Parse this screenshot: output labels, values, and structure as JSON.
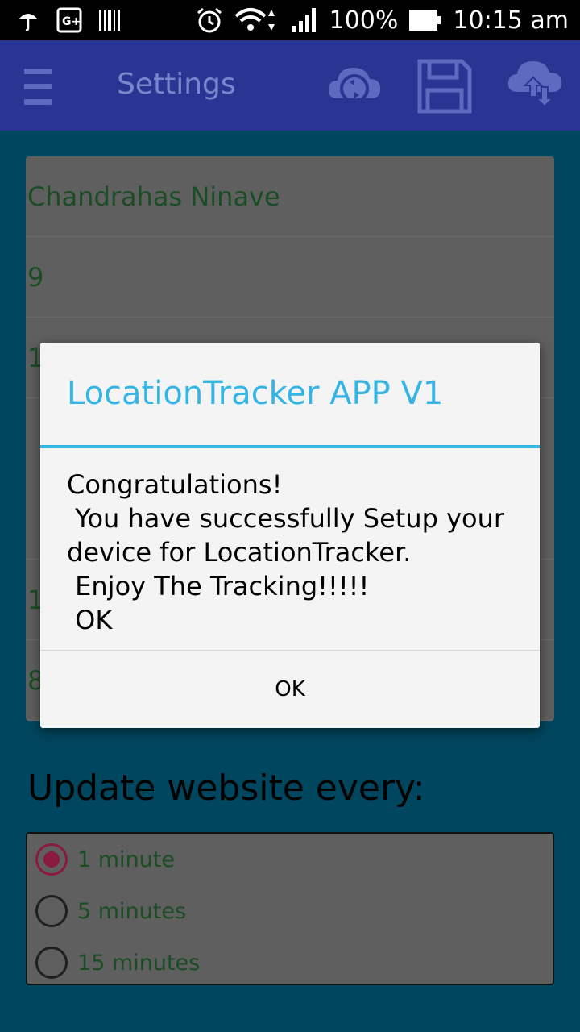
{
  "status_bar": {
    "icons": [
      "umbrella-icon",
      "gplus-icon",
      "barcode-icon",
      "alarm-icon",
      "wifi-icon",
      "signal-icon",
      "battery-icon"
    ],
    "battery": "100%",
    "time": "10:15 am"
  },
  "app_bar": {
    "title": "Settings",
    "icons": [
      "menu-icon",
      "cloud-sync-icon",
      "save-icon",
      "cloud-upload-download-icon"
    ],
    "color": "#283593"
  },
  "settings_card": {
    "rows": [
      "Chandrahas Ninave",
      "9",
      "1",
      "",
      "1",
      "8"
    ]
  },
  "update_section": {
    "label": "Update website every:",
    "options": [
      {
        "label": "1 minute",
        "selected": true
      },
      {
        "label": "5 minutes",
        "selected": false
      },
      {
        "label": "15 minutes",
        "selected": false
      }
    ]
  },
  "dialog": {
    "title": "LocationTracker APP V1",
    "message_lines": [
      "Congratulations!",
      " You have successfully Setup your",
      "device for LocationTracker.",
      " Enjoy The Tracking!!!!!",
      " OK"
    ],
    "button": "OK",
    "accent_color": "#33b5e5"
  }
}
